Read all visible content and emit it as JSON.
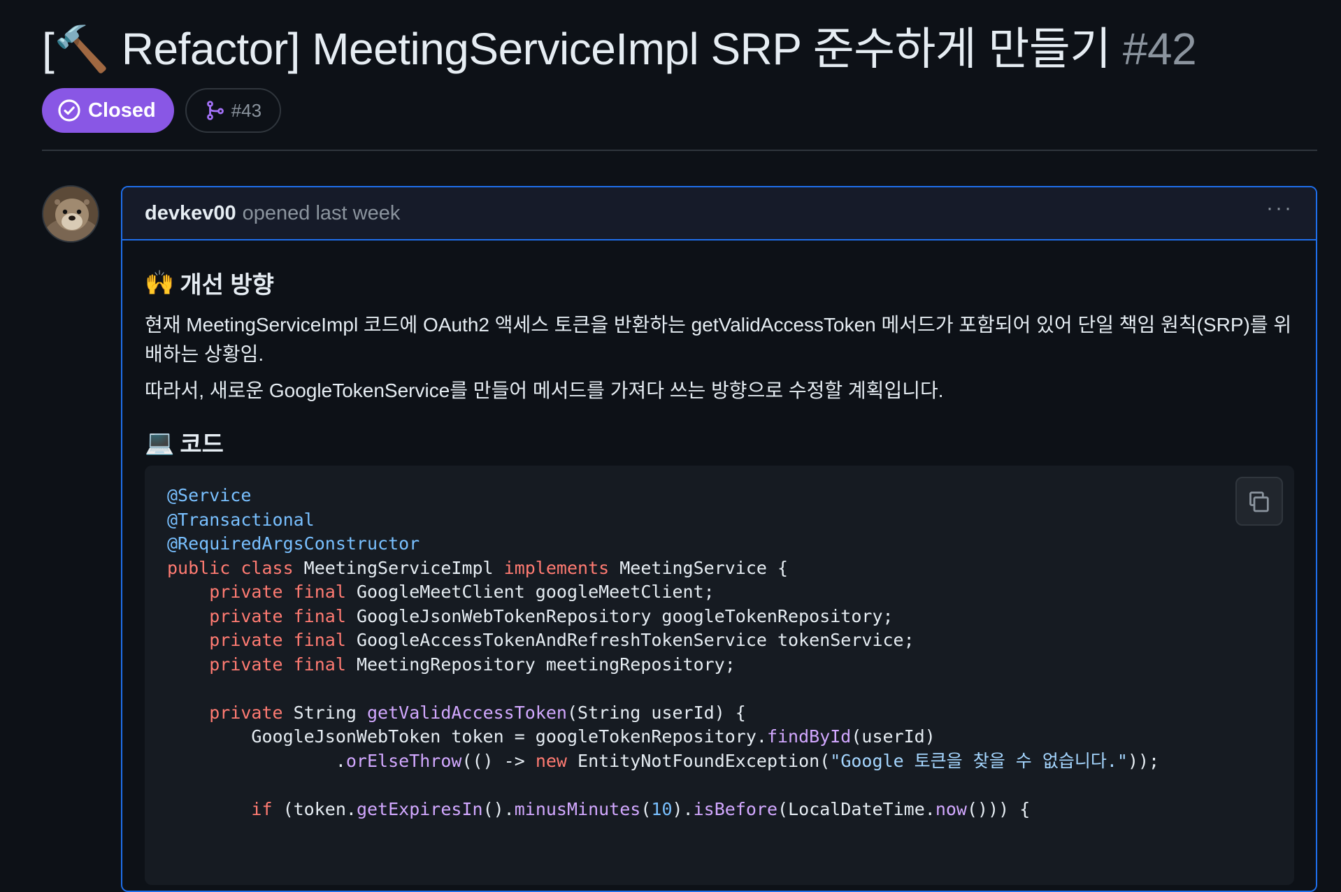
{
  "issue": {
    "title": "[🔨 Refactor] MeetingServiceImpl SRP 준수하게 만들기",
    "number": "#42",
    "state_label": "Closed",
    "state_icon": "issue-closed-icon",
    "state_color": "#8957e5",
    "linked_pr": "#43",
    "linked_pr_icon": "git-pull-request-icon"
  },
  "comment": {
    "author": "devkev00",
    "opened_text": "opened last week",
    "menu_label": "···",
    "sections": [
      {
        "heading_emoji": "🙌",
        "heading": "개선 방향"
      },
      {
        "heading_emoji": "💻",
        "heading": "코드"
      }
    ],
    "paragraphs": [
      "현재 MeetingServiceImpl 코드에 OAuth2 액세스 토큰을 반환하는 getValidAccessToken 메서드가 포함되어 있어 단일 책임 원칙(SRP)를 위배하는 상황임.",
      "따라서, 새로운 GoogleTokenService를 만들어 메서드를 가져다 쓰는 방향으로 수정할 계획입니다."
    ],
    "code_language": "java",
    "code_lines": [
      [
        [
          "anno",
          "@Service"
        ]
      ],
      [
        [
          "anno",
          "@Transactional"
        ]
      ],
      [
        [
          "anno",
          "@RequiredArgsConstructor"
        ]
      ],
      [
        [
          "kw",
          "public class "
        ],
        [
          "plain",
          "MeetingServiceImpl "
        ],
        [
          "kw",
          "implements "
        ],
        [
          "plain",
          "MeetingService {"
        ]
      ],
      [
        [
          "plain",
          "    "
        ],
        [
          "kw",
          "private final "
        ],
        [
          "plain",
          "GoogleMeetClient googleMeetClient;"
        ]
      ],
      [
        [
          "plain",
          "    "
        ],
        [
          "kw",
          "private final "
        ],
        [
          "plain",
          "GoogleJsonWebTokenRepository googleTokenRepository;"
        ]
      ],
      [
        [
          "plain",
          "    "
        ],
        [
          "kw",
          "private final "
        ],
        [
          "plain",
          "GoogleAccessTokenAndRefreshTokenService tokenService;"
        ]
      ],
      [
        [
          "plain",
          "    "
        ],
        [
          "kw",
          "private final "
        ],
        [
          "plain",
          "MeetingRepository meetingRepository;"
        ]
      ],
      [
        [
          "plain",
          ""
        ]
      ],
      [
        [
          "plain",
          "    "
        ],
        [
          "kw",
          "private "
        ],
        [
          "plain",
          "String "
        ],
        [
          "fn",
          "getValidAccessToken"
        ],
        [
          "plain",
          "(String userId) {"
        ]
      ],
      [
        [
          "plain",
          "        GoogleJsonWebToken token = googleTokenRepository."
        ],
        [
          "fn",
          "findById"
        ],
        [
          "plain",
          "(userId)"
        ]
      ],
      [
        [
          "plain",
          "                ."
        ],
        [
          "fn",
          "orElseThrow"
        ],
        [
          "plain",
          "(() -> "
        ],
        [
          "kw",
          "new "
        ],
        [
          "plain",
          "EntityNotFoundException("
        ],
        [
          "str",
          "\"Google 토큰을 찾을 수 없습니다.\""
        ],
        [
          "plain",
          "));"
        ]
      ],
      [
        [
          "plain",
          ""
        ]
      ],
      [
        [
          "plain",
          "        "
        ],
        [
          "kw",
          "if "
        ],
        [
          "plain",
          "(token."
        ],
        [
          "fn",
          "getExpiresIn"
        ],
        [
          "plain",
          "()."
        ],
        [
          "fn",
          "minusMinutes"
        ],
        [
          "plain",
          "("
        ],
        [
          "num",
          "10"
        ],
        [
          "plain",
          ")."
        ],
        [
          "fn",
          "isBefore"
        ],
        [
          "plain",
          "(LocalDateTime."
        ],
        [
          "fn",
          "now"
        ],
        [
          "plain",
          "())) {"
        ]
      ]
    ],
    "copy_icon": "copy-icon"
  }
}
